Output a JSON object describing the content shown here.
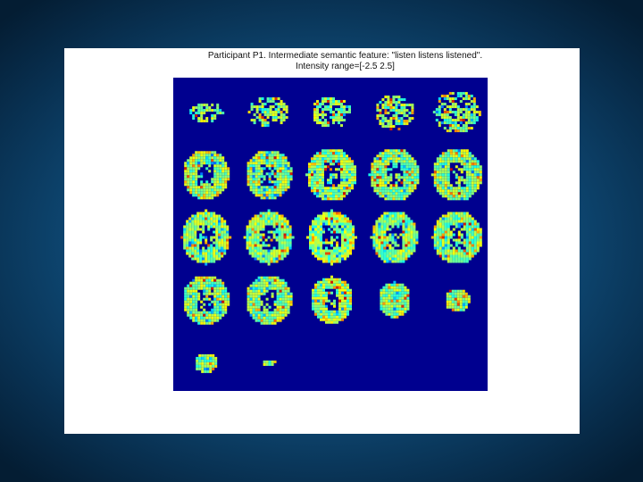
{
  "figure": {
    "title": "Participant P1. Intermediate semantic feature: \"listen listens listened\".",
    "subtitle": "Intensity range=[-2.5 2.5]",
    "intensity_range": [
      -2.5,
      2.5
    ],
    "background_color": "#00008f",
    "colormap": "jet",
    "grid": {
      "rows": 5,
      "cols": 5,
      "slices_shown": 22
    }
  }
}
